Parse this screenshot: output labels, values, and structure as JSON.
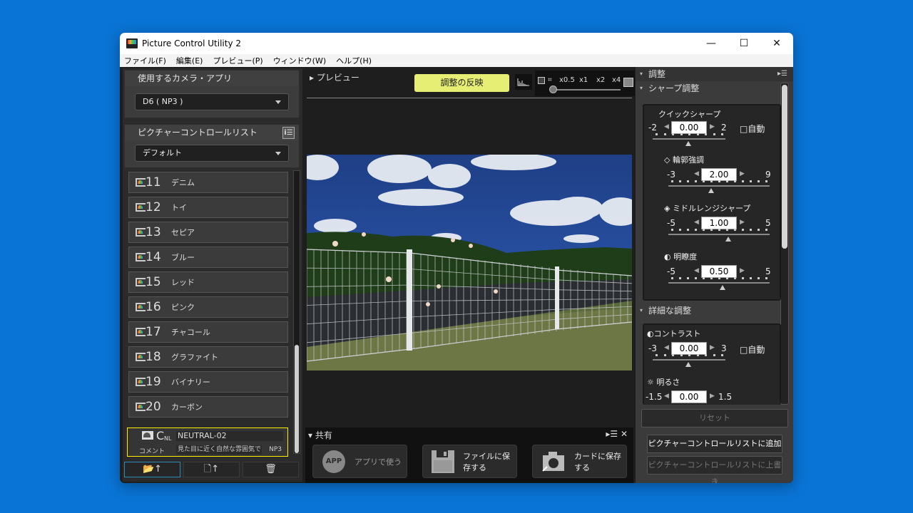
{
  "window": {
    "title": "Picture Control Utility 2",
    "controls": {
      "minimize": "—",
      "maximize": "☐",
      "close": "✕"
    }
  },
  "menu": [
    "ファイル(F)",
    "編集(E)",
    "プレビュー(P)",
    "ウィンドウ(W)",
    "ヘルプ(H)"
  ],
  "left": {
    "camera_section": {
      "title": "使用するカメラ・アプリ",
      "selected": "D6 ( NP3 )"
    },
    "list_section": {
      "title": "ピクチャーコントロールリスト",
      "selected": "デフォルト",
      "info_icon": "i☰"
    },
    "items": [
      {
        "num": "11",
        "name": "デニム"
      },
      {
        "num": "12",
        "name": "トイ"
      },
      {
        "num": "13",
        "name": "セピア"
      },
      {
        "num": "14",
        "name": "ブルー"
      },
      {
        "num": "15",
        "name": "レッド"
      },
      {
        "num": "16",
        "name": "ピンク"
      },
      {
        "num": "17",
        "name": "チャコール"
      },
      {
        "num": "18",
        "name": "グラファイト"
      },
      {
        "num": "19",
        "name": "バイナリー"
      },
      {
        "num": "20",
        "name": "カーボン"
      }
    ],
    "selected_item": {
      "base_letter": "C",
      "base_sub": "NL",
      "name": "NEUTRAL-02",
      "comment_label": "コメント",
      "comment": "見た目に近く自然な雰囲気で…",
      "profile": "NP3"
    },
    "bottom_buttons": {
      "open": "📂↑",
      "export": "🗋↑",
      "delete": "🗑"
    }
  },
  "preview": {
    "title": "プレビュー",
    "apply_button": "調整の反映",
    "histogram_icon": "histogram",
    "zoom_levels": [
      "x0.5",
      "x1",
      "x2",
      "x4"
    ]
  },
  "share": {
    "title": "共有",
    "buttons": [
      {
        "label": "アプリで使う",
        "icon": "APP",
        "enabled": false
      },
      {
        "label": "ファイルに保存する",
        "icon": "floppy",
        "enabled": true
      },
      {
        "label": "カードに保存する",
        "icon": "camera",
        "enabled": true
      }
    ]
  },
  "adjust": {
    "title": "調整",
    "sharpening_section": "シャープ調整",
    "quick_sharp": {
      "label": "クイックシャープ",
      "min": "-2",
      "max": "2",
      "value": "0.00",
      "auto_label": "□自動"
    },
    "sharpening": {
      "label": "輪郭強調",
      "min": "-3",
      "max": "9",
      "value": "2.00"
    },
    "midrange": {
      "label": "ミドルレンジシャープ",
      "min": "-5",
      "max": "5",
      "value": "1.00"
    },
    "clarity": {
      "label": "明瞭度",
      "min": "-5",
      "max": "5",
      "value": "0.50"
    },
    "detail_section": "詳細な調整",
    "contrast": {
      "label": "コントラスト",
      "min": "-3",
      "max": "3",
      "value": "0.00",
      "auto_label": "□自動"
    },
    "brightness": {
      "label": "明るさ",
      "min": "-1.5",
      "max": "1.5",
      "value": "0.00"
    },
    "reset_button": "リセット",
    "add_button": "ピクチャーコントロールリストに追加",
    "overwrite_button": "ピクチャーコントロールリストに上書き"
  }
}
